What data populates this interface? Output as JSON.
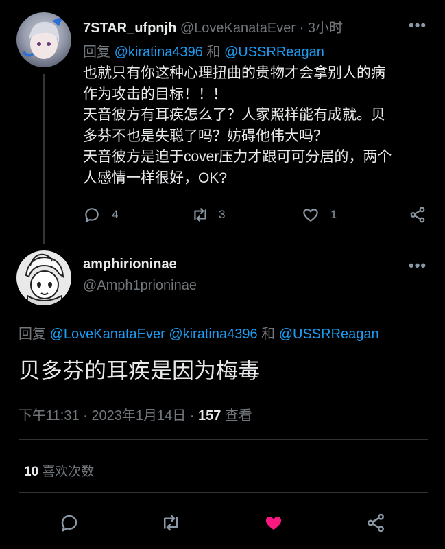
{
  "reply_tweet": {
    "display_name": "7STAR_ufpnjh",
    "handle": "@LoveKanataEver",
    "separator": "·",
    "time": "3小时",
    "more_icon": "more-dots-icon",
    "reply_prefix": "回复",
    "reply_to_1": "@kiratina4396",
    "reply_and": "和",
    "reply_to_2": "@USSRReagan",
    "text_lines": [
      "也就只有你这种心理扭曲的贵物才会拿别人的病",
      "作为攻击的目标！！！",
      "天音彼方有耳疾怎么了？人家照样能有成就。贝",
      "多芬不也是失聪了吗？妨碍他伟大吗？",
      "天音彼方是迫于cover压力才跟可可分居的，两个",
      "人感情一样很好，OK?"
    ],
    "actions": {
      "reply_count": "4",
      "retweet_count": "3",
      "like_count": "1"
    }
  },
  "main_tweet": {
    "display_name": "amphirioninae",
    "handle": "@Amph1prioninae",
    "reply_prefix": "回复",
    "reply_to_1": "@LoveKanataEver",
    "reply_to_2": "@kiratina4396",
    "reply_and": "和",
    "reply_to_3": "@USSRReagan",
    "text": "贝多芬的耳疾是因为梅毒",
    "timestamp": "下午11:31 · 2023年1月14日 ·",
    "views_count": "157",
    "views_label": "查看",
    "likes_count": "10",
    "likes_label": "喜欢次数"
  },
  "colors": {
    "background": "#000000",
    "text": "#e7e9ea",
    "muted": "#71767b",
    "link": "#1d9bf0",
    "like_active": "#f91880",
    "divider": "#2f3336"
  }
}
